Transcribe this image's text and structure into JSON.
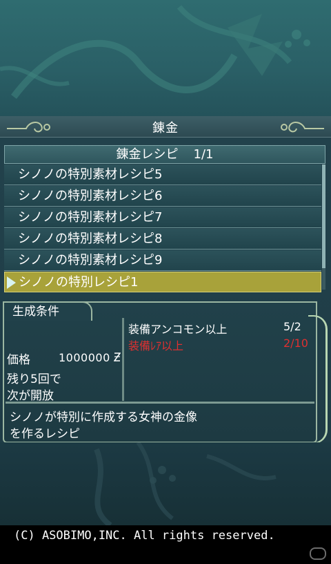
{
  "header": {
    "title": "錬金"
  },
  "recipe_list": {
    "header_label": "錬金レシピ",
    "header_count": "1/1",
    "items": [
      {
        "label": "シノノの特別素材レシピ5",
        "selected": false
      },
      {
        "label": "シノノの特別素材レシピ6",
        "selected": false
      },
      {
        "label": "シノノの特別素材レシピ7",
        "selected": false
      },
      {
        "label": "シノノの特別素材レシピ8",
        "selected": false
      },
      {
        "label": "シノノの特別素材レシピ9",
        "selected": false
      },
      {
        "label": "シノノの特別レシピ1",
        "selected": true
      }
    ]
  },
  "conditions": {
    "tab_label": "生成条件",
    "requirements": [
      {
        "label": "装備アンコモン以上",
        "value": "5/2",
        "status": "ok"
      },
      {
        "label": "装備ﾚｱ以上",
        "value": "2/10",
        "status": "ng"
      }
    ],
    "price_label": "価格",
    "price_value": "1000000",
    "currency_icon": "gold-currency-icon",
    "remain_line1": "残り5回で",
    "remain_line2": "次が開放",
    "description_line1": "シノノが特別に作成する女神の金像",
    "description_line2": "を作るレシピ"
  },
  "footer": {
    "copyright": "(C) ASOBIMO,INC. All rights reserved."
  },
  "colors": {
    "selected_highlight": "#a8a23a",
    "requirement_not_met": "#e03030",
    "panel_border": "#9cb7a2"
  }
}
